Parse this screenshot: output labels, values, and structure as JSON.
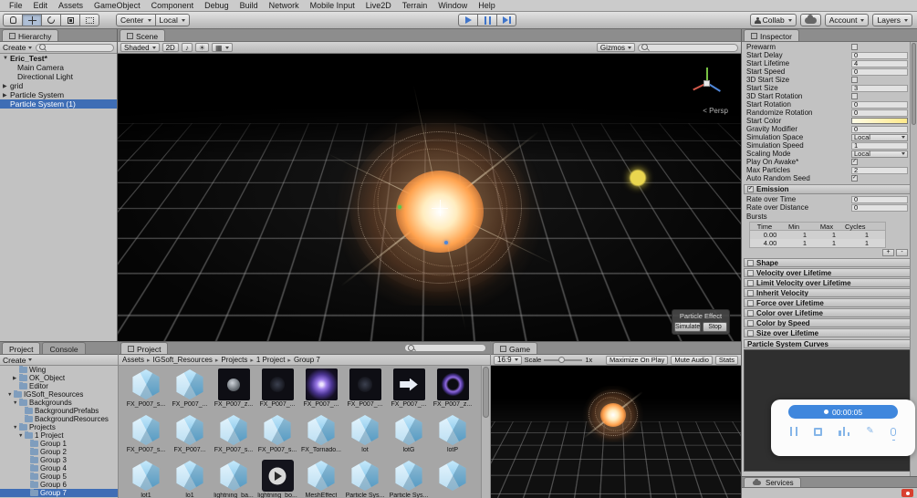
{
  "menu": [
    "File",
    "Edit",
    "Assets",
    "GameObject",
    "Component",
    "Debug",
    "Build",
    "Network",
    "Mobile Input",
    "Live2D",
    "Terrain",
    "Window",
    "Help"
  ],
  "toolbar": {
    "pivot": "Center",
    "space": "Local",
    "collab": "Collab",
    "account": "Account",
    "layers": "Layers"
  },
  "hierarchy": {
    "tab": "Hierarchy",
    "create": "Create",
    "items": [
      {
        "label": "Eric_Test*",
        "depth": 0,
        "arrow": "▼",
        "bold": true
      },
      {
        "label": "Main Camera",
        "depth": 1
      },
      {
        "label": "Directional Light",
        "depth": 1
      },
      {
        "label": "grid",
        "depth": 0,
        "arrow": "▶"
      },
      {
        "label": "Particle System",
        "depth": 0,
        "arrow": "▶"
      },
      {
        "label": "Particle System (1)",
        "depth": 0,
        "selected": true
      }
    ]
  },
  "scene": {
    "tab": "Scene",
    "shading": "Shaded",
    "toggle_2d": "2D",
    "icons": {
      "audio": "♪",
      "lighting": "☀",
      "effects": "▦"
    },
    "gizmos": "Gizmos",
    "persp": "< Persp",
    "effect_panel": {
      "title": "Particle Effect",
      "simulate": "Simulate",
      "stop": "Stop"
    }
  },
  "inspector": {
    "tab": "Inspector",
    "rows": [
      {
        "label": "Prewarm",
        "is_checkbox": true,
        "checked": false
      },
      {
        "label": "Start Delay",
        "has_value": true,
        "value": "0"
      },
      {
        "label": "Start Lifetime",
        "has_value": true,
        "value": "4"
      },
      {
        "label": "Start Speed",
        "has_value": true,
        "value": "0"
      },
      {
        "label": "3D Start Size",
        "is_checkbox": true,
        "checked": false
      },
      {
        "label": "Start Size",
        "has_value": true,
        "value": "3"
      },
      {
        "label": "3D Start Rotation",
        "is_checkbox": true,
        "checked": false
      },
      {
        "label": "Start Rotation",
        "has_value": true,
        "value": "0"
      },
      {
        "label": "Randomize Rotation",
        "has_value": true,
        "value": "0"
      },
      {
        "label": "Start Color",
        "is_color": true
      },
      {
        "label": "Gravity Modifier",
        "has_value": true,
        "value": "0"
      },
      {
        "label": "Simulation Space",
        "is_dropdown": true,
        "value": "Local"
      },
      {
        "label": "Simulation Speed",
        "has_value": true,
        "value": "1"
      },
      {
        "label": "Scaling Mode",
        "is_dropdown": true,
        "value": "Local"
      },
      {
        "label": "Play On Awake*",
        "is_checkbox": true,
        "checked": true
      },
      {
        "label": "Max Particles",
        "has_value": true,
        "value": "2"
      },
      {
        "label": "Auto Random Seed",
        "is_checkbox": true,
        "checked": true
      }
    ],
    "emission": {
      "title": "Emission",
      "rows": [
        {
          "label": "Rate over Time",
          "has_value": true,
          "value": "0"
        },
        {
          "label": "Rate over Distance",
          "has_value": true,
          "value": "0"
        }
      ],
      "bursts_label": "Bursts",
      "headers": [
        "Time",
        "Min",
        "Max",
        "Cycles"
      ],
      "bursts": [
        [
          "0.00",
          "1",
          "1",
          "1"
        ],
        [
          "4.00",
          "1",
          "1",
          "1"
        ]
      ],
      "add_label": "+",
      "remove_label": "-"
    },
    "modules": [
      "Shape",
      "Velocity over Lifetime",
      "Limit Velocity over Lifetime",
      "Inherit Velocity",
      "Force over Lifetime",
      "Color over Lifetime",
      "Color by Speed",
      "Size over Lifetime"
    ],
    "curves_title": "Particle System Curves"
  },
  "project": {
    "tab_project": "Project",
    "tab_console": "Console",
    "main_tab": "Project",
    "create": "Create",
    "tree": [
      {
        "label": "Wing",
        "depth": 2
      },
      {
        "label": "OK_Object",
        "depth": 2,
        "arrow": "▶"
      },
      {
        "label": "Editor",
        "depth": 2
      },
      {
        "label": "IGSoft_Resources",
        "depth": 1,
        "arrow": "▼"
      },
      {
        "label": "Backgrounds",
        "depth": 2,
        "arrow": "▼"
      },
      {
        "label": "BackgroundPrefabs",
        "depth": 3
      },
      {
        "label": "BackgroundResources",
        "depth": 3
      },
      {
        "label": "Projects",
        "depth": 2,
        "arrow": "▼"
      },
      {
        "label": "1 Project",
        "depth": 3,
        "arrow": "▼"
      },
      {
        "label": "Group 1",
        "depth": 4
      },
      {
        "label": "Group 2",
        "depth": 4
      },
      {
        "label": "Group 3",
        "depth": 4
      },
      {
        "label": "Group 4",
        "depth": 4
      },
      {
        "label": "Group 5",
        "depth": 4
      },
      {
        "label": "Group 6",
        "depth": 4
      },
      {
        "label": "Group 7",
        "depth": 4,
        "selected": true
      }
    ],
    "breadcrumb": [
      "Assets",
      "IGSoft_Resources",
      "Projects",
      "1 Project",
      "Group 7"
    ],
    "assets": [
      {
        "name": "FX_P007_s...",
        "icon": "cube"
      },
      {
        "name": "FX_P007_...",
        "icon": "cube"
      },
      {
        "name": "FX_P007_z...",
        "icon": "fxsphere"
      },
      {
        "name": "FX_P007_...",
        "icon": "fxfaint"
      },
      {
        "name": "FX_P007_...",
        "icon": "fxswirl"
      },
      {
        "name": "FX_P007_...",
        "icon": "fxfaint"
      },
      {
        "name": "FX_P007_...",
        "icon": "fxarrow"
      },
      {
        "name": "FX_P007_z...",
        "icon": "fxring"
      },
      {
        "name": "FX_P007_s...",
        "icon": "cube"
      },
      {
        "name": "FX_P007...",
        "icon": "cube"
      },
      {
        "name": "FX_P007_s...",
        "icon": "cube"
      },
      {
        "name": "FX_P007_s...",
        "icon": "cube"
      },
      {
        "name": "FX_Tornado...",
        "icon": "cube"
      },
      {
        "name": "lot",
        "icon": "cube"
      },
      {
        "name": "lotG",
        "icon": "cube"
      },
      {
        "name": "lotP",
        "icon": "cube"
      },
      {
        "name": "lot1",
        "icon": "cube"
      },
      {
        "name": "lo1",
        "icon": "cube"
      },
      {
        "name": "lightning_ba...",
        "icon": "cube"
      },
      {
        "name": "lightning_bo...",
        "icon": "play"
      },
      {
        "name": "MeshEffect",
        "icon": "cube"
      },
      {
        "name": "Particle Sys...",
        "icon": "cube"
      },
      {
        "name": "Particle Sys...",
        "icon": "cube"
      },
      {
        "name": "",
        "icon": "cube"
      }
    ]
  },
  "game": {
    "tab": "Game",
    "aspect": "16:9",
    "scale_label": "Scale",
    "scale_value": "1x",
    "maximize": "Maximize On Play",
    "mute": "Mute Audio",
    "stats": "Stats"
  },
  "recorder": {
    "time": "00:00:05"
  },
  "services": {
    "tab": "Services"
  }
}
